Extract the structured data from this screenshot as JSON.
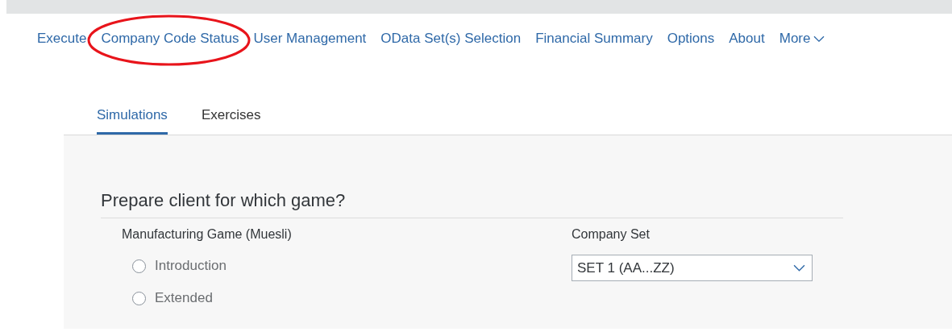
{
  "nav": [
    {
      "label": "Execute",
      "highlighted": false
    },
    {
      "label": "Company Code Status",
      "highlighted": true
    },
    {
      "label": "User Management",
      "highlighted": false
    },
    {
      "label": "OData Set(s) Selection",
      "highlighted": false
    },
    {
      "label": "Financial Summary",
      "highlighted": false
    },
    {
      "label": "Options",
      "highlighted": false
    },
    {
      "label": "About",
      "highlighted": false
    },
    {
      "label": "More",
      "highlighted": false,
      "kind": "menu"
    }
  ],
  "tabs": [
    {
      "label": "Simulations",
      "selected": true
    },
    {
      "label": "Exercises",
      "selected": false
    }
  ],
  "form": {
    "title": "Prepare client for which game?",
    "game": {
      "label": "Manufacturing Game (Muesli)",
      "options": [
        {
          "label": "Introduction",
          "selected": false
        },
        {
          "label": "Extended",
          "selected": false
        }
      ]
    },
    "company_set": {
      "label": "Company Set",
      "value": "SET 1 (AA...ZZ)"
    }
  }
}
